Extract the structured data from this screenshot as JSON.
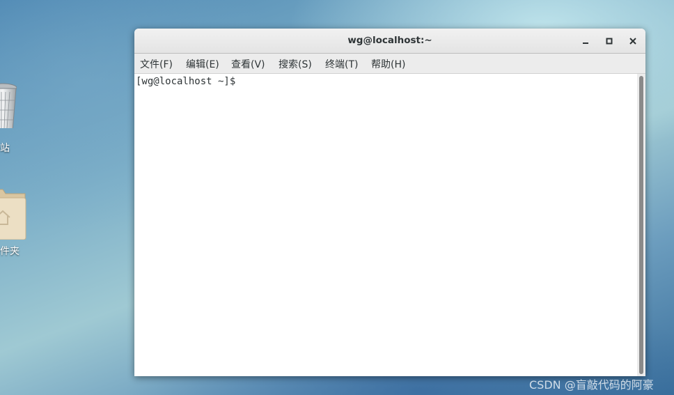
{
  "desktop": {
    "icons": [
      {
        "label": "站",
        "icon": "trash-icon"
      },
      {
        "label": "件夹",
        "icon": "home-folder-icon"
      }
    ]
  },
  "window": {
    "title": "wg@localhost:~",
    "controls": {
      "minimize": "minimize-icon",
      "maximize": "maximize-icon",
      "close": "close-icon"
    }
  },
  "menubar": {
    "items": [
      {
        "label": "文件(F)"
      },
      {
        "label": "编辑(E)"
      },
      {
        "label": "查看(V)"
      },
      {
        "label": "搜索(S)"
      },
      {
        "label": "终端(T)"
      },
      {
        "label": "帮助(H)"
      }
    ]
  },
  "terminal": {
    "prompt": "[wg@localhost ~]$ "
  },
  "watermark": {
    "text": "CSDN @盲敲代码的阿豪"
  }
}
